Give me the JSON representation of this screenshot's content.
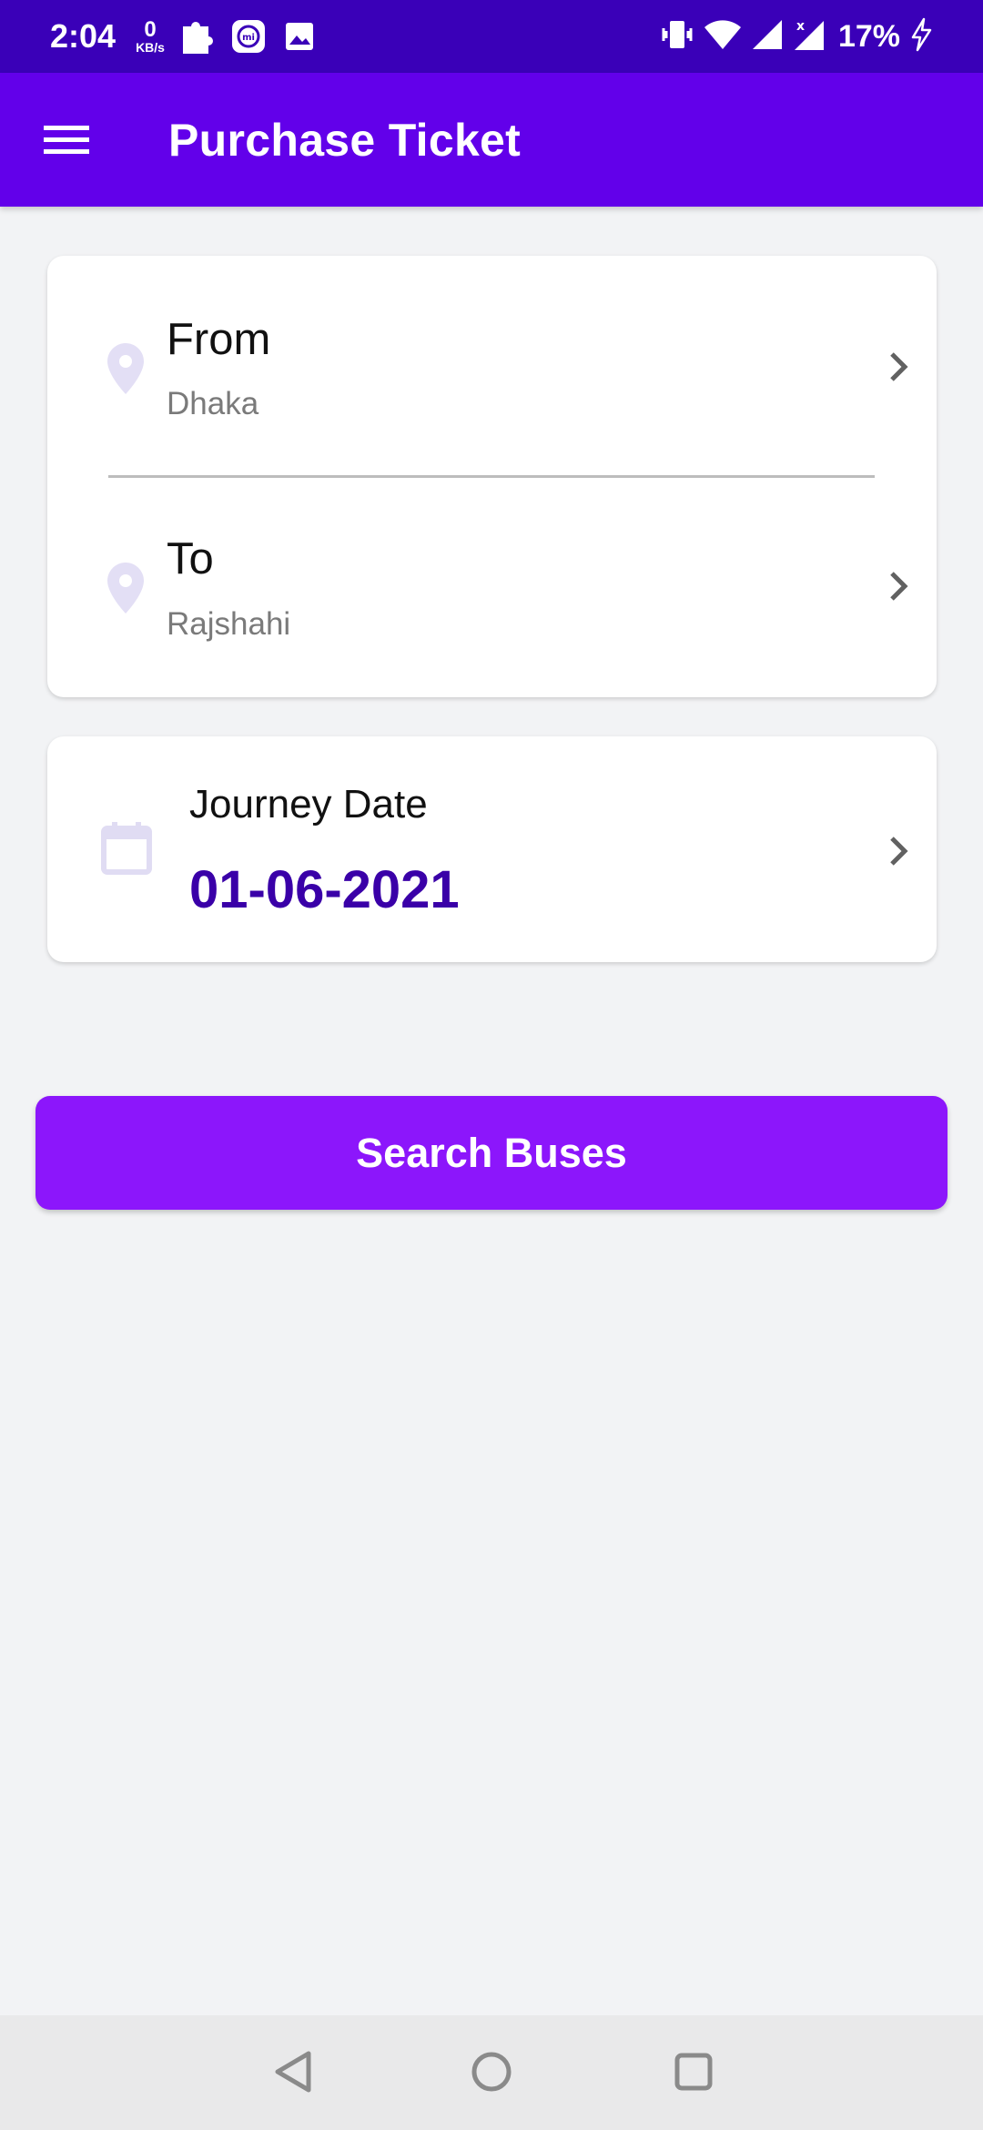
{
  "status_bar": {
    "time": "2:04",
    "net_speed_value": "0",
    "net_speed_unit": "KB/s",
    "battery": "17%",
    "icons": [
      "puzzle-icon",
      "mi-icon",
      "image-icon",
      "vibrate-icon",
      "wifi-icon",
      "signal-icon",
      "signal-x-icon",
      "charging-icon"
    ]
  },
  "app_bar": {
    "title": "Purchase Ticket",
    "menu_icon": "hamburger-menu-icon",
    "color": "#6200ea"
  },
  "route": {
    "from": {
      "label": "From",
      "value": "Dhaka"
    },
    "to": {
      "label": "To",
      "value": "Rajshahi"
    }
  },
  "journey": {
    "label": "Journey Date",
    "date": "01-06-2021"
  },
  "actions": {
    "search_label": "Search Buses",
    "color": "#8c16fb"
  },
  "nav_bar": {
    "icons": [
      "back-icon",
      "home-icon",
      "recents-icon"
    ]
  }
}
